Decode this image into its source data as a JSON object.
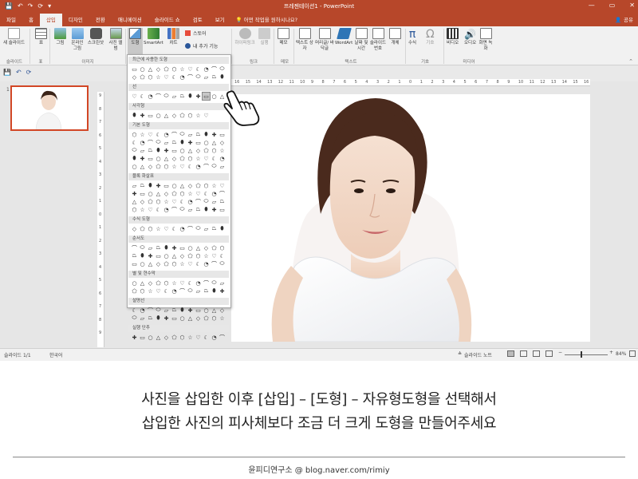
{
  "app": {
    "qat": [
      "💾",
      "↶",
      "↷",
      "⟳",
      "▾"
    ],
    "title": "프레젠테이션1 - PowerPoint",
    "window_buttons": [
      "—",
      "▭",
      "✕"
    ],
    "tabs": [
      "파일",
      "홈",
      "삽입",
      "디자인",
      "전환",
      "애니메이션",
      "슬라이드 쇼",
      "검토",
      "보기"
    ],
    "tell_me": "어떤 작업을 원하시나요?",
    "share": "공유"
  },
  "ribbon": {
    "buttons": [
      "새 슬라이드",
      "표",
      "그림",
      "온라인 그림",
      "스크린샷",
      "사진 앨범",
      "도형",
      "SmartArt",
      "차트",
      "스토어",
      "내 추가 기능",
      "하이퍼링크",
      "실행",
      "메모",
      "텍스트 상자",
      "머리글/ 바닥글",
      "WordArt",
      "날짜 및 시간",
      "슬라이드 번호",
      "개체",
      "수식",
      "기호",
      "비디오",
      "오디오",
      "화면 녹화"
    ],
    "groups": [
      "슬라이드",
      "표",
      "이미지",
      "링크",
      "메모",
      "텍스트",
      "기호",
      "미디어"
    ]
  },
  "colors": {
    "brand": "#b7472a",
    "selected_thumb": "#d24726",
    "ribbon": "#f1f1f1"
  },
  "ruler": {
    "labels": [
      "16",
      "15",
      "14",
      "13",
      "12",
      "11",
      "10",
      "9",
      "8",
      "7",
      "6",
      "5",
      "4",
      "3",
      "2",
      "1",
      "0",
      "1",
      "2",
      "3",
      "4",
      "5",
      "6",
      "7",
      "8",
      "9",
      "10",
      "11",
      "12",
      "13",
      "14",
      "15",
      "16"
    ]
  },
  "thumbnail": {
    "number": "1"
  },
  "shapes_gallery": {
    "sections": [
      "최근에 사용한 도형",
      "선",
      "사각형",
      "기본 도형",
      "블록 화살표",
      "수식 도형",
      "순서도",
      "별 및 현수막",
      "설명선",
      "실행 단추"
    ]
  },
  "statusbar": {
    "slide": "슬라이드 1/1",
    "language": "한국어",
    "notes": "슬라이드 노트",
    "zoom": "84%"
  },
  "caption": {
    "line1": "사진을 삽입한 이후 [삽입] – [도형] – 자유형도형을 선택해서",
    "line2": "삽입한 사진의 피사체보다 조금 더 크게 도형을 만들어주세요",
    "credit": "윤피디연구소 @ blog.naver.com/rimiy"
  }
}
